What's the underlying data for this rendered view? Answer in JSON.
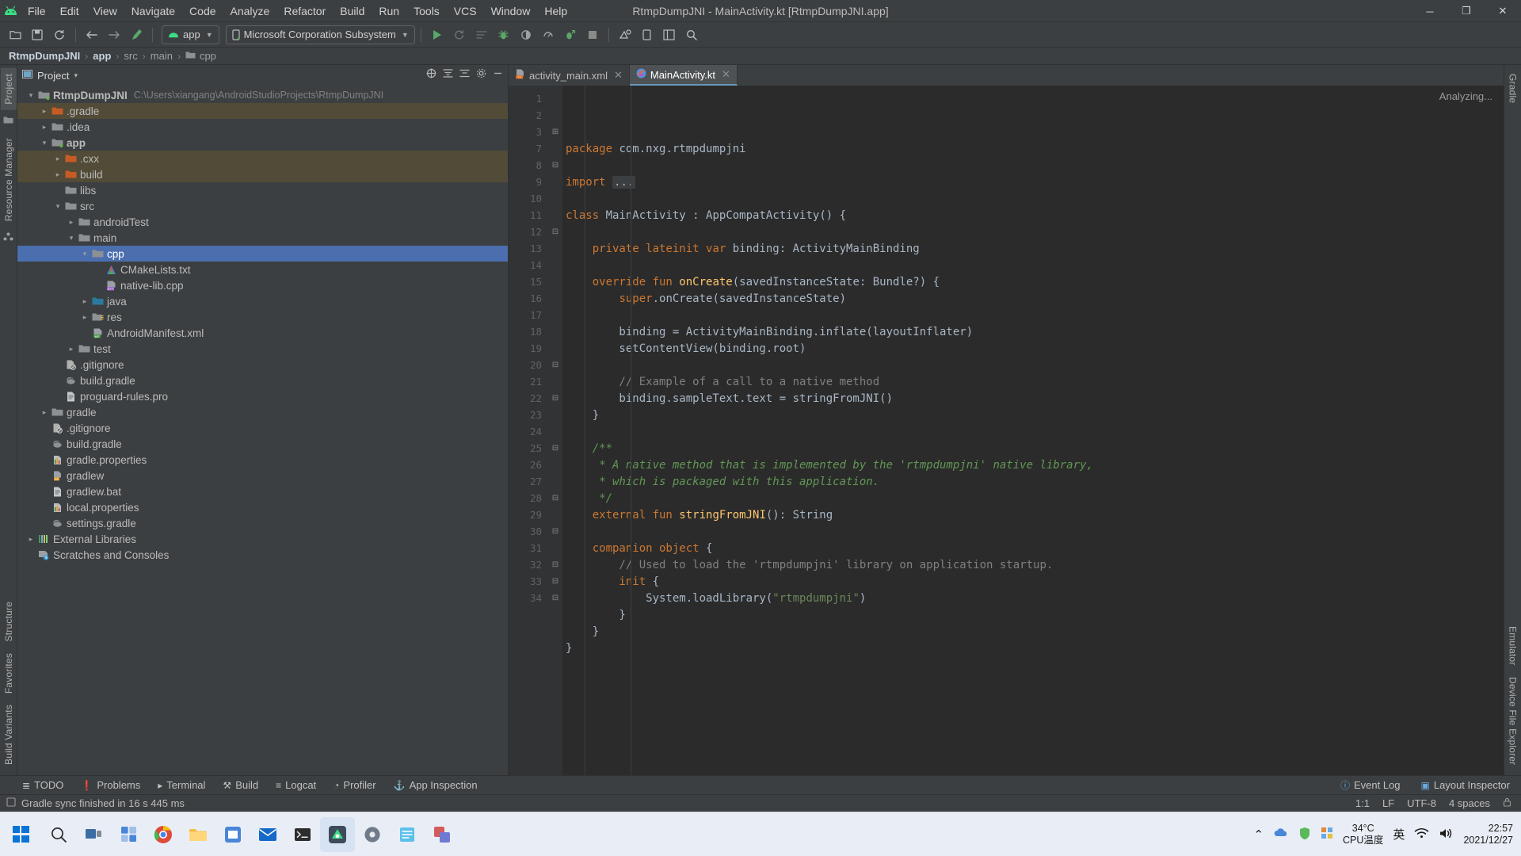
{
  "window": {
    "title": "RtmpDumpJNI - MainActivity.kt [RtmpDumpJNI.app]",
    "minimize": "─",
    "maximize": "❐",
    "close": "✕"
  },
  "menubar": {
    "logo_name": "android-studio-logo",
    "items": [
      "File",
      "Edit",
      "View",
      "Navigate",
      "Code",
      "Analyze",
      "Refactor",
      "Build",
      "Run",
      "Tools",
      "VCS",
      "Window",
      "Help"
    ]
  },
  "toolbar": {
    "buttons": [
      {
        "name": "open-folder-icon",
        "glyph": "📁"
      },
      {
        "name": "save-all-icon",
        "glyph": "💾"
      },
      {
        "name": "sync-project-icon",
        "glyph": "↻"
      },
      {
        "name": "back-icon",
        "glyph": "←"
      },
      {
        "name": "forward-icon",
        "glyph": "→"
      },
      {
        "name": "build-hammer-icon",
        "glyph": "⚒"
      }
    ],
    "module_selector": {
      "label": "app",
      "icon": "android-head-icon"
    },
    "device_selector": {
      "label": "Microsoft Corporation Subsystem",
      "icon": "phone-icon"
    },
    "run_buttons": [
      {
        "name": "run-icon",
        "glyph": "▶",
        "color": "#59a869"
      },
      {
        "name": "apply-changes-icon",
        "glyph": "↺",
        "color": "#6e6e6e"
      },
      {
        "name": "apply-code-changes-icon",
        "glyph": "☰",
        "color": "#6e6e6e"
      },
      {
        "name": "debug-icon",
        "glyph": "🐞",
        "color": "#59a869"
      },
      {
        "name": "attach-debugger-icon",
        "glyph": "◑",
        "color": "#9aa0a6"
      },
      {
        "name": "profiler-icon",
        "glyph": "◔",
        "color": "#9aa0a6"
      },
      {
        "name": "run-with-coverage-icon",
        "glyph": "↑",
        "color": "#59a869"
      },
      {
        "name": "stop-icon",
        "glyph": "■",
        "color": "#8a8a8a"
      }
    ],
    "right_buttons": [
      {
        "name": "sdk-manager-icon",
        "glyph": "⚙"
      },
      {
        "name": "avd-manager-icon",
        "glyph": "▭"
      },
      {
        "name": "project-structure-icon",
        "glyph": "⊞"
      },
      {
        "name": "search-everywhere-icon",
        "glyph": "🔍"
      }
    ]
  },
  "breadcrumb": {
    "items": [
      "RtmpDumpJNI",
      "app",
      "src",
      "main",
      "cpp"
    ]
  },
  "left_strip": {
    "tabs": [
      "Project",
      "Resource Manager"
    ],
    "active": "Project",
    "bottom_tabs": [
      "Structure",
      "Favorites",
      "Build Variants"
    ]
  },
  "right_strip": {
    "tabs": [
      "Gradle",
      "Emulator",
      "Device File Explorer"
    ]
  },
  "project_panel": {
    "title": "Project",
    "caret": "▾",
    "actions": [
      {
        "name": "select-opened-file-icon",
        "glyph": "⊕"
      },
      {
        "name": "expand-all-icon",
        "glyph": "≣"
      },
      {
        "name": "collapse-all-icon",
        "glyph": "≡"
      },
      {
        "name": "settings-gear-icon",
        "glyph": "⚙"
      },
      {
        "name": "hide-panel-icon",
        "glyph": "─"
      }
    ],
    "tree": [
      {
        "indent": 0,
        "arrow": "⌄",
        "icon": "module-icon",
        "label": "RtmpDumpJNI",
        "bold": true,
        "sub": "C:\\Users\\xiangang\\AndroidStudioProjects\\RtmpDumpJNI",
        "state": "normal"
      },
      {
        "indent": 1,
        "arrow": "›",
        "icon": "folder-orange-icon",
        "label": ".gradle",
        "state": "highlight"
      },
      {
        "indent": 1,
        "arrow": "›",
        "icon": "folder-icon",
        "label": ".idea",
        "state": "normal"
      },
      {
        "indent": 1,
        "arrow": "⌄",
        "icon": "module-icon",
        "label": "app",
        "bold": true,
        "state": "normal"
      },
      {
        "indent": 2,
        "arrow": "›",
        "icon": "folder-orange-icon",
        "label": ".cxx",
        "state": "highlight"
      },
      {
        "indent": 2,
        "arrow": "›",
        "icon": "folder-orange-icon",
        "label": "build",
        "state": "highlight"
      },
      {
        "indent": 2,
        "arrow": "",
        "icon": "folder-icon",
        "label": "libs",
        "state": "normal"
      },
      {
        "indent": 2,
        "arrow": "⌄",
        "icon": "folder-icon",
        "label": "src",
        "state": "normal"
      },
      {
        "indent": 3,
        "arrow": "›",
        "icon": "folder-icon",
        "label": "androidTest",
        "state": "normal"
      },
      {
        "indent": 3,
        "arrow": "⌄",
        "icon": "folder-icon",
        "label": "main",
        "state": "normal"
      },
      {
        "indent": 4,
        "arrow": "⌄",
        "icon": "folder-icon",
        "label": "cpp",
        "state": "selected"
      },
      {
        "indent": 5,
        "arrow": "",
        "icon": "cmake-icon",
        "label": "CMakeLists.txt",
        "state": "normal"
      },
      {
        "indent": 5,
        "arrow": "",
        "icon": "cpp-file-icon",
        "label": "native-lib.cpp",
        "state": "normal"
      },
      {
        "indent": 4,
        "arrow": "›",
        "icon": "folder-java-icon",
        "label": "java",
        "state": "normal"
      },
      {
        "indent": 4,
        "arrow": "›",
        "icon": "folder-res-icon",
        "label": "res",
        "state": "normal"
      },
      {
        "indent": 4,
        "arrow": "",
        "icon": "manifest-file-icon",
        "label": "AndroidManifest.xml",
        "state": "normal"
      },
      {
        "indent": 3,
        "arrow": "›",
        "icon": "folder-icon",
        "label": "test",
        "state": "normal"
      },
      {
        "indent": 2,
        "arrow": "",
        "icon": "gitignore-icon",
        "label": ".gitignore",
        "state": "normal"
      },
      {
        "indent": 2,
        "arrow": "",
        "icon": "gradle-file-icon",
        "label": "build.gradle",
        "state": "normal"
      },
      {
        "indent": 2,
        "arrow": "",
        "icon": "text-file-icon",
        "label": "proguard-rules.pro",
        "state": "normal"
      },
      {
        "indent": 1,
        "arrow": "›",
        "icon": "folder-icon",
        "label": "gradle",
        "state": "normal"
      },
      {
        "indent": 1,
        "arrow": "",
        "icon": "gitignore-icon",
        "label": ".gitignore",
        "state": "normal"
      },
      {
        "indent": 1,
        "arrow": "",
        "icon": "gradle-file-icon",
        "label": "build.gradle",
        "state": "normal"
      },
      {
        "indent": 1,
        "arrow": "",
        "icon": "properties-file-icon",
        "label": "gradle.properties",
        "state": "normal"
      },
      {
        "indent": 1,
        "arrow": "",
        "icon": "shell-file-icon",
        "label": "gradlew",
        "state": "normal"
      },
      {
        "indent": 1,
        "arrow": "",
        "icon": "text-file-icon",
        "label": "gradlew.bat",
        "state": "normal"
      },
      {
        "indent": 1,
        "arrow": "",
        "icon": "properties-file-icon",
        "label": "local.properties",
        "state": "normal"
      },
      {
        "indent": 1,
        "arrow": "",
        "icon": "gradle-file-icon",
        "label": "settings.gradle",
        "state": "normal"
      },
      {
        "indent": 0,
        "arrow": "›",
        "icon": "external-libraries-icon",
        "label": "External Libraries",
        "state": "normal"
      },
      {
        "indent": 0,
        "arrow": "",
        "icon": "scratches-icon",
        "label": "Scratches and Consoles",
        "state": "normal"
      }
    ]
  },
  "editor": {
    "tabs": [
      {
        "label": "activity_main.xml",
        "icon": "xml-layout-file-icon",
        "active": false,
        "close": "✕"
      },
      {
        "label": "MainActivity.kt",
        "icon": "kotlin-file-icon",
        "active": true,
        "close": "✕"
      }
    ],
    "status_overlay": "Analyzing...",
    "line_numbers": [
      1,
      2,
      3,
      7,
      8,
      9,
      10,
      11,
      12,
      13,
      14,
      15,
      16,
      17,
      18,
      19,
      20,
      21,
      22,
      23,
      24,
      25,
      26,
      27,
      28,
      29,
      30,
      31,
      32,
      33,
      34
    ],
    "lines": [
      {
        "n": 1,
        "fold": "",
        "segs": [
          {
            "t": "package ",
            "c": "k"
          },
          {
            "t": "com.nxg.rtmpdumpjni",
            "c": "ty"
          }
        ]
      },
      {
        "n": 2,
        "fold": "",
        "segs": []
      },
      {
        "n": 3,
        "fold": "+",
        "segs": [
          {
            "t": "import ",
            "c": "k"
          },
          {
            "t": "...",
            "c": "foldm"
          }
        ]
      },
      {
        "n": 7,
        "fold": "",
        "segs": []
      },
      {
        "n": 8,
        "fold": "-",
        "segs": [
          {
            "t": "class ",
            "c": "k"
          },
          {
            "t": "MainActivity",
            "c": "ty"
          },
          {
            "t": " : ",
            "c": "ty"
          },
          {
            "t": "AppCompatActivity() {",
            "c": "ty"
          }
        ]
      },
      {
        "n": 9,
        "fold": "",
        "segs": []
      },
      {
        "n": 10,
        "fold": "",
        "segs": [
          {
            "t": "    private lateinit var ",
            "c": "k"
          },
          {
            "t": "binding: ActivityMainBinding",
            "c": "ty"
          }
        ]
      },
      {
        "n": 11,
        "fold": "",
        "segs": []
      },
      {
        "n": 12,
        "fold": "-",
        "segs": [
          {
            "t": "    override fun ",
            "c": "k"
          },
          {
            "t": "onCreate",
            "c": "fn"
          },
          {
            "t": "(savedInstanceState: Bundle?) {",
            "c": "ty"
          }
        ]
      },
      {
        "n": 13,
        "fold": "",
        "segs": [
          {
            "t": "        ",
            "c": "ty"
          },
          {
            "t": "super",
            "c": "k"
          },
          {
            "t": ".onCreate(savedInstanceState)",
            "c": "ty"
          }
        ]
      },
      {
        "n": 14,
        "fold": "",
        "segs": []
      },
      {
        "n": 15,
        "fold": "",
        "segs": [
          {
            "t": "        binding = ActivityMainBinding.inflate(layoutInflater)",
            "c": "ty"
          }
        ]
      },
      {
        "n": 16,
        "fold": "",
        "segs": [
          {
            "t": "        setContentView(binding.root)",
            "c": "ty"
          }
        ]
      },
      {
        "n": 17,
        "fold": "",
        "segs": []
      },
      {
        "n": 18,
        "fold": "",
        "segs": [
          {
            "t": "        // Example of a call to a native method",
            "c": "cm"
          }
        ]
      },
      {
        "n": 19,
        "fold": "",
        "segs": [
          {
            "t": "        binding.sampleText.text = stringFromJNI()",
            "c": "ty"
          }
        ]
      },
      {
        "n": 20,
        "fold": "-",
        "segs": [
          {
            "t": "    }",
            "c": "ty"
          }
        ]
      },
      {
        "n": 21,
        "fold": "",
        "segs": []
      },
      {
        "n": 22,
        "fold": "-",
        "segs": [
          {
            "t": "    /**",
            "c": "doc"
          }
        ]
      },
      {
        "n": 23,
        "fold": "",
        "segs": [
          {
            "t": "     * A native method that is implemented by the 'rtmpdumpjni' native library,",
            "c": "doc"
          }
        ]
      },
      {
        "n": 24,
        "fold": "",
        "segs": [
          {
            "t": "     * which is packaged with this application.",
            "c": "doc"
          }
        ]
      },
      {
        "n": 25,
        "fold": "-",
        "segs": [
          {
            "t": "     */",
            "c": "doc"
          }
        ]
      },
      {
        "n": 26,
        "fold": "",
        "segs": [
          {
            "t": "    external fun ",
            "c": "k"
          },
          {
            "t": "stringFromJNI",
            "c": "fn"
          },
          {
            "t": "(): ",
            "c": "ty"
          },
          {
            "t": "String",
            "c": "ty"
          }
        ]
      },
      {
        "n": 27,
        "fold": "",
        "segs": []
      },
      {
        "n": 28,
        "fold": "-",
        "segs": [
          {
            "t": "    companion object ",
            "c": "k"
          },
          {
            "t": "{",
            "c": "ty"
          }
        ]
      },
      {
        "n": 29,
        "fold": "",
        "segs": [
          {
            "t": "        // Used to load the 'rtmpdumpjni' library on application startup.",
            "c": "cm"
          }
        ]
      },
      {
        "n": 30,
        "fold": "-",
        "segs": [
          {
            "t": "        init ",
            "c": "k"
          },
          {
            "t": "{",
            "c": "ty"
          }
        ]
      },
      {
        "n": 31,
        "fold": "",
        "segs": [
          {
            "t": "            System.loadLibrary(",
            "c": "ty"
          },
          {
            "t": "\"rtmpdumpjni\"",
            "c": "st"
          },
          {
            "t": ")",
            "c": "ty"
          }
        ]
      },
      {
        "n": 32,
        "fold": "-",
        "segs": [
          {
            "t": "        }",
            "c": "ty"
          }
        ]
      },
      {
        "n": 33,
        "fold": "-",
        "segs": [
          {
            "t": "    }",
            "c": "ty"
          }
        ]
      },
      {
        "n": 34,
        "fold": "-",
        "segs": [
          {
            "t": "}",
            "c": "ty"
          }
        ]
      }
    ]
  },
  "bottom_bar": {
    "items": [
      {
        "label": "TODO",
        "icon": "todo-icon",
        "glyph": "≣"
      },
      {
        "label": "Problems",
        "icon": "problems-icon",
        "glyph": "❗"
      },
      {
        "label": "Terminal",
        "icon": "terminal-icon",
        "glyph": "▸"
      },
      {
        "label": "Build",
        "icon": "build-hammer-icon",
        "glyph": "⚒"
      },
      {
        "label": "Logcat",
        "icon": "logcat-icon",
        "glyph": "≡"
      },
      {
        "label": "Profiler",
        "icon": "profiler-icon",
        "glyph": "◔"
      },
      {
        "label": "App Inspection",
        "icon": "app-inspection-icon",
        "glyph": "⚓"
      }
    ],
    "right_items": [
      {
        "label": "Event Log",
        "icon": "event-log-icon",
        "glyph": "ⓘ"
      },
      {
        "label": "Layout Inspector",
        "icon": "layout-inspector-icon",
        "glyph": "▣"
      }
    ]
  },
  "status_bar": {
    "message": "Gradle sync finished in 16 s 445 ms",
    "message_icon": "notification-icon",
    "right": [
      "1:1",
      "LF",
      "UTF-8",
      "4 spaces"
    ],
    "lock_icon": "lock-icon"
  },
  "taskbar": {
    "start_icon": "windows-start-icon",
    "icons": [
      {
        "name": "search-icon",
        "glyph": "🔍"
      },
      {
        "name": "task-view-icon",
        "glyph": "▭"
      },
      {
        "name": "widgets-icon",
        "glyph": "▣"
      },
      {
        "name": "chrome-icon",
        "glyph": "●"
      },
      {
        "name": "file-explorer-icon",
        "glyph": "📁"
      },
      {
        "name": "store-icon",
        "glyph": "⊞"
      },
      {
        "name": "mail-icon",
        "glyph": "✉"
      },
      {
        "name": "terminal-icon",
        "glyph": "⌨"
      },
      {
        "name": "android-studio-icon",
        "glyph": "▲",
        "active": true
      },
      {
        "name": "settings-icon",
        "glyph": "⚙"
      },
      {
        "name": "notepad-icon",
        "glyph": "▭"
      },
      {
        "name": "app-icon",
        "glyph": "■"
      }
    ],
    "tray": {
      "chevron": "⌃",
      "icons": [
        {
          "name": "cloud-icon",
          "glyph": "☁"
        },
        {
          "name": "shield-icon",
          "glyph": "⛉"
        },
        {
          "name": "overflow-icon",
          "glyph": "◆"
        }
      ],
      "ime": "英",
      "wifi": "ᴧ",
      "volume": "🔊"
    },
    "cpu": {
      "temp": "34°C",
      "label": "CPU温度"
    },
    "clock": {
      "time": "22:57",
      "date": "2021/12/27"
    }
  }
}
